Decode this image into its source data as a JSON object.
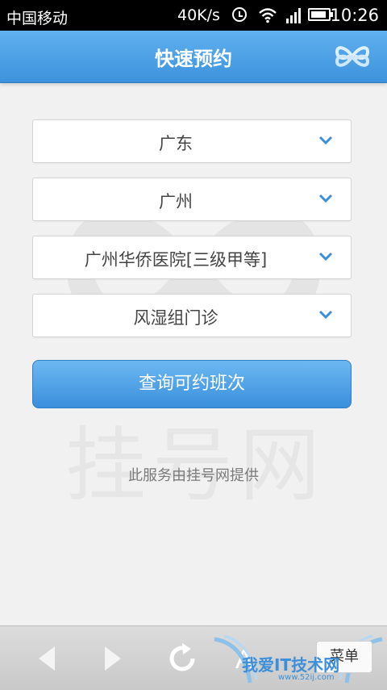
{
  "status_bar": {
    "carrier": "中国移动",
    "speed": "40K/s",
    "time": "10:26"
  },
  "header": {
    "title": "快速预约"
  },
  "watermark": {
    "text": "挂号网"
  },
  "form": {
    "province": "广东",
    "city": "广州",
    "hospital": "广州华侨医院[三级甲等]",
    "department": "风湿组门诊",
    "query_button": "查询可约班次"
  },
  "footer": {
    "provider_note": "此服务由挂号网提供"
  },
  "toolbar": {
    "menu_label": "菜单",
    "site_watermark": "我爱IT技术网",
    "site_watermark_url": "www.52ij.com"
  },
  "colors": {
    "accent": "#3d92dc",
    "chevron": "#3a8fd9"
  }
}
